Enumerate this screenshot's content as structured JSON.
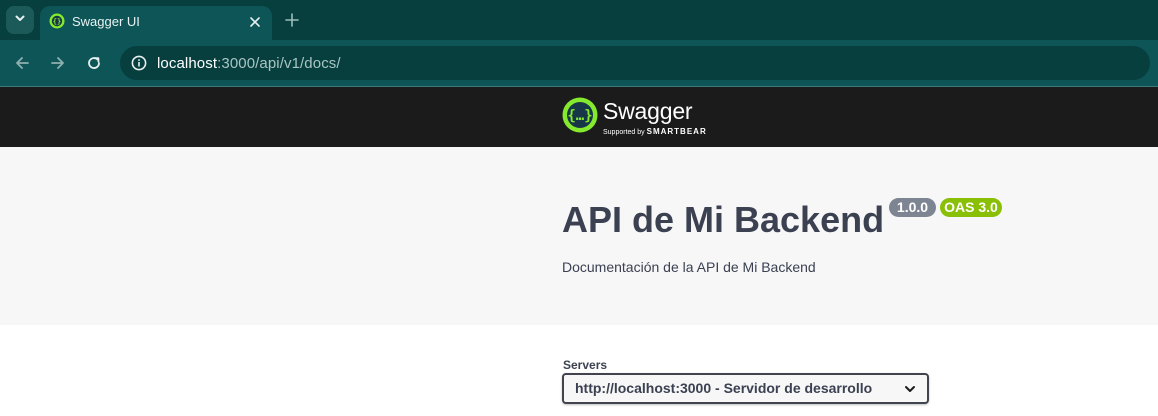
{
  "browser": {
    "tab": {
      "title": "Swagger UI",
      "favicon": "swagger-favicon-icon"
    },
    "url": {
      "host": "localhost",
      "rest": ":3000/api/v1/docs/"
    },
    "icons": [
      "chevron-down-icon",
      "close-icon",
      "plus-icon",
      "back-arrow-icon",
      "forward-arrow-icon",
      "reload-icon",
      "site-info-icon"
    ],
    "colors": {
      "tabstrip": "#073f3f",
      "toolbar": "#0e5557"
    }
  },
  "swagger": {
    "logo": {
      "text": "Swagger",
      "supported_by": "Supported by",
      "brand": "SMARTBEAR"
    },
    "info": {
      "title": "API de Mi Backend",
      "version": "1.0.0",
      "oas": "OAS 3.0",
      "description": "Documentación de la API de Mi Backend"
    },
    "servers": {
      "label": "Servers",
      "selected": "http://localhost:3000 - Servidor de desarrollo"
    },
    "colors": {
      "topbar": "#1b1b1b",
      "logo_green": "#85ea2d",
      "oas_badge": "#89bf04",
      "version_badge": "#7d8492",
      "text": "#3b4151"
    }
  }
}
